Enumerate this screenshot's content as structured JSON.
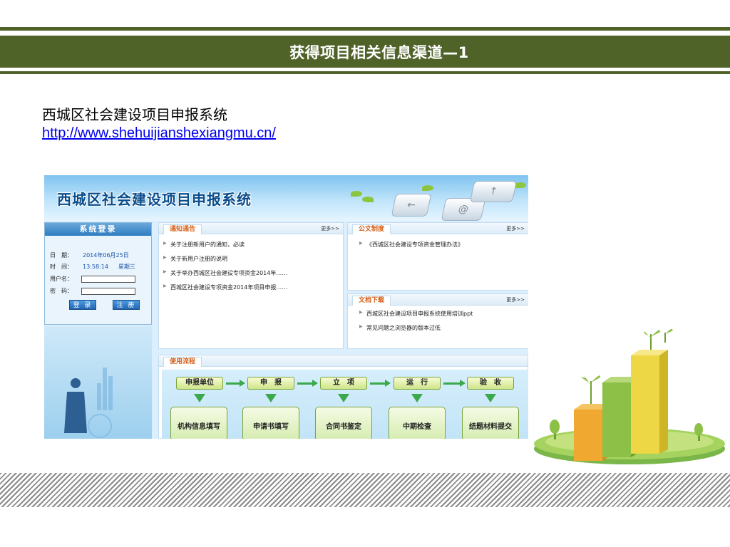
{
  "slide": {
    "title": "获得项目相关信息渠道—1",
    "system_name": "西城区社会建设项目申报系统",
    "url": "http://www.shehuijianshexiangmu.cn/",
    "colors": {
      "band": "#4f6228",
      "link": "#0000ee"
    }
  },
  "screenshot": {
    "banner_title": "西城区社会建设项目申报系统",
    "keys": [
      "@",
      "↑",
      "←"
    ],
    "login": {
      "header": "系统登录",
      "date_label": "日　期：",
      "date_value": "2014年06月25日",
      "time_label": "时　间：",
      "time_value": "13:58:14",
      "weekday": "星期三",
      "username_label": "用户名：",
      "password_label": "密　码：",
      "login_button": "登 录",
      "register_button": "注 册"
    },
    "notices": {
      "tab": "通知通告",
      "more": "更多>>",
      "items": [
        "关于注册新用户的通知，必读",
        "关于新用户注册的说明",
        "关于举办西城区社会建设专项资金2014年……",
        "西城区社会建设专项资金2014年项目申报……"
      ]
    },
    "policies": {
      "tab": "公文制度",
      "more": "更多>>",
      "items": [
        "《西城区社会建设专项资金管理办法》"
      ]
    },
    "downloads": {
      "tab": "文档下载",
      "more": "更多>>",
      "items": [
        "西城区社会建设项目申报系统使用培训ppt",
        "常见问题之浏览器的版本过低"
      ]
    },
    "flow": {
      "tab": "使用流程",
      "steps": [
        "申报单位",
        "申　报",
        "立　项",
        "运　行",
        "验　收"
      ],
      "boxes": [
        "机构信息填写",
        "申请书填写",
        "合同书鉴定",
        "中期检查",
        "结题材料提交"
      ]
    }
  }
}
